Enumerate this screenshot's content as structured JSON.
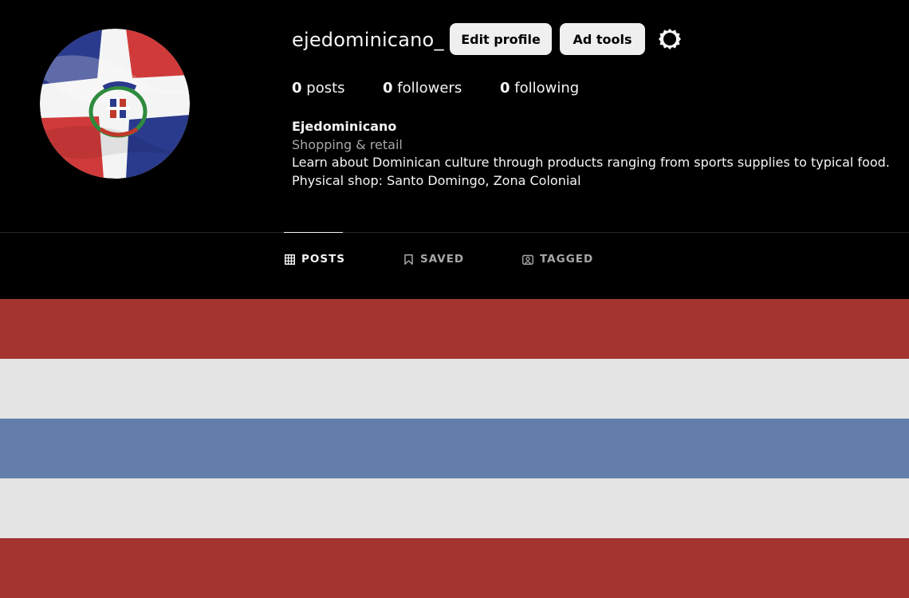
{
  "profile": {
    "username": "ejedominicano_",
    "avatar_icon": "dominican-flag-avatar-icon"
  },
  "actions": {
    "edit_profile_label": "Edit profile",
    "ad_tools_label": "Ad tools",
    "settings_icon": "gear-icon"
  },
  "stats": {
    "posts_count": "0",
    "posts_label": "posts",
    "followers_count": "0",
    "followers_label": "followers",
    "following_count": "0",
    "following_label": "following"
  },
  "bio": {
    "name": "Ejedominicano",
    "category": "Shopping & retail",
    "line1": "Learn about Dominican culture through products ranging from sports supplies to typical food.",
    "line2": "Physical shop: Santo Domingo, Zona Colonial"
  },
  "tabs": [
    {
      "label": "POSTS",
      "icon": "grid-icon",
      "active": true
    },
    {
      "label": "SAVED",
      "icon": "bookmark-icon",
      "active": false
    },
    {
      "label": "TAGGED",
      "icon": "tagged-person-icon",
      "active": false
    }
  ],
  "colors": {
    "background": "#000000",
    "button_bg": "#efefef",
    "muted_text": "#a8a8a8",
    "stripe_red": "#a33430",
    "stripe_white": "#e5e5e5",
    "stripe_blue": "#647eab"
  },
  "stripes": [
    "#a33430",
    "#e5e5e5",
    "#647eab",
    "#e5e5e5",
    "#a33430"
  ]
}
